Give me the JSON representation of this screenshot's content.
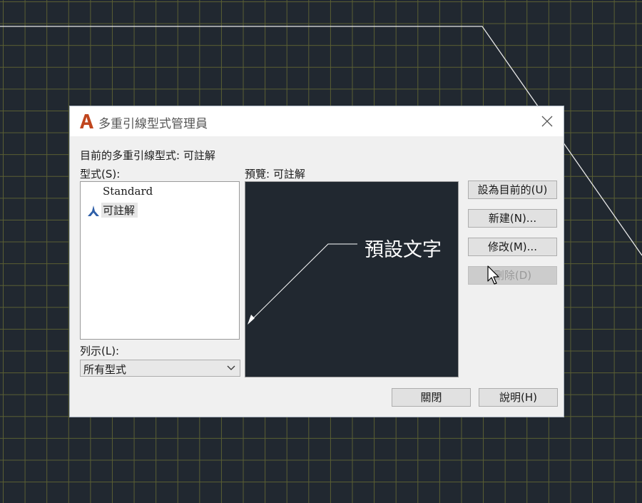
{
  "dialog": {
    "title": "多重引線型式管理員",
    "current_style_label": "目前的多重引線型式: 可註解",
    "styles_label": "型式(S):",
    "preview_label": "預覽: 可註解",
    "list_label": "列示(L):",
    "list_filter_value": "所有型式",
    "styles": [
      {
        "name": "Standard",
        "annotative": false,
        "selected": false
      },
      {
        "name": "可註解",
        "annotative": true,
        "selected": true
      }
    ],
    "preview_text": "預設文字",
    "buttons": {
      "set_current": "設為目前的(U)",
      "new": "新建(N)...",
      "modify": "修改(M)...",
      "delete": "刪除(D)",
      "close": "關閉",
      "help": "說明(H)"
    }
  },
  "icons": {
    "app": "autocad-logo-icon",
    "close": "close-icon",
    "annotative": "annotative-icon",
    "dropdown": "chevron-down-icon",
    "cursor": "mouse-cursor-icon"
  },
  "colors": {
    "canvas_bg": "#212830",
    "grid": "#5a5f33",
    "logo": "#c0461e",
    "annotative_icon": "#2e5fa8",
    "dialog_bg": "#f0f0f0"
  }
}
